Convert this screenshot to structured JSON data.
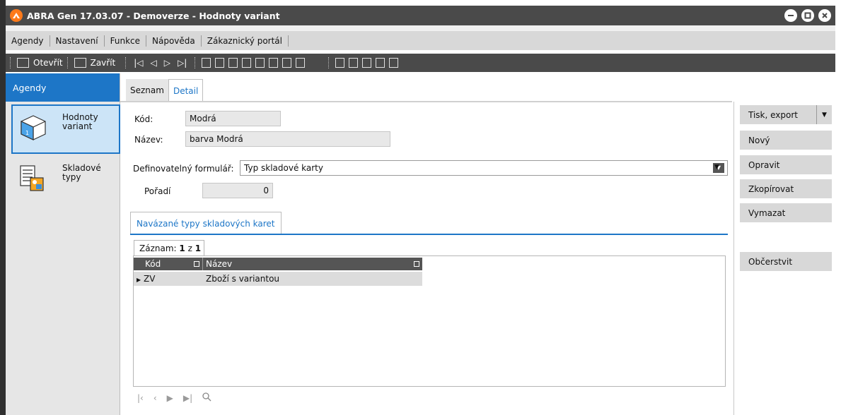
{
  "window": {
    "title": "ABRA Gen 17.03.07 - Demoverze - Hodnoty variant"
  },
  "menu": [
    "Agendy",
    "Nastavení",
    "Funkce",
    "Nápověda",
    "Zákaznický portál"
  ],
  "toolbar": {
    "open_label": "Otevřít",
    "close_label": "Zavřít"
  },
  "sidebar": {
    "header": "Agendy",
    "items": [
      {
        "label_line1": "Hodnoty",
        "label_line2": "variant",
        "icon": "cube-icon",
        "active": true
      },
      {
        "label_line1": "Skladové",
        "label_line2": "typy",
        "icon": "stock-types-icon",
        "active": false
      }
    ]
  },
  "tabs": [
    {
      "label": "Seznam",
      "active": false
    },
    {
      "label": "Detail",
      "active": true
    }
  ],
  "form": {
    "kod_label": "Kód:",
    "kod_value": "Modrá",
    "nazev_label": "Název:",
    "nazev_value": "barva Modrá",
    "formular_label": "Definovatelný formulář:",
    "formular_value": "Typ skladové karty",
    "poradi_label": "Pořadí",
    "poradi_value": "0"
  },
  "subtab": {
    "label": "Navázané typy skladových karet"
  },
  "grid": {
    "record_label": "Záznam:",
    "record_current": "1",
    "record_of": "z",
    "record_total": "1",
    "columns": [
      "Kód",
      "Název"
    ],
    "rows": [
      {
        "kod": "ZV",
        "nazev": "Zboží s variantou"
      }
    ]
  },
  "actions": {
    "print": "Tisk, export",
    "new": "Nový",
    "edit": "Opravit",
    "copy": "Zkopírovat",
    "delete": "Vymazat",
    "refresh": "Občerstvit"
  },
  "colors": {
    "accent": "#1d76c7",
    "titlebar": "#4a4a4a",
    "logo": "#ff7a1a"
  }
}
